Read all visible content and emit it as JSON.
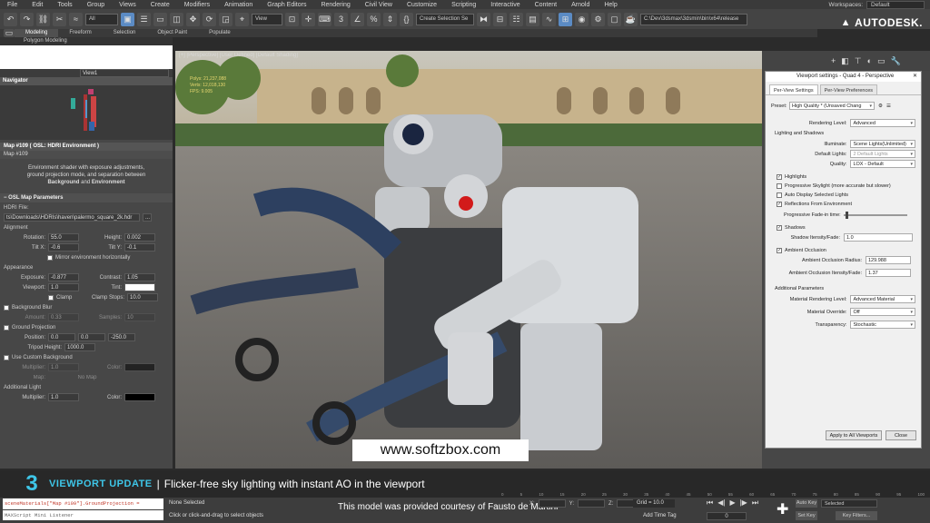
{
  "menu": [
    "File",
    "Edit",
    "Tools",
    "Group",
    "Views",
    "Create",
    "Modifiers",
    "Animation",
    "Graph Editors",
    "Rendering",
    "Civil View",
    "Customize",
    "Scripting",
    "Interactive",
    "Content",
    "Arnold",
    "Help"
  ],
  "workspace": {
    "label": "Workspaces:",
    "value": "Default"
  },
  "toolbar": {
    "filter": "All",
    "view": "View",
    "selection_set": "Create Selection Se",
    "path": "C:\\Dev\\3dsmax\\3dsmin\\bin\\x64\\release"
  },
  "brand": "AUTODESK.",
  "ribbon": {
    "tabs": [
      "Modeling",
      "Freeform",
      "Selection",
      "Object Paint",
      "Populate"
    ],
    "active": "Modeling",
    "sub": "Polygon Modeling"
  },
  "left": {
    "view": "View1",
    "navigator": "Navigator",
    "map_header": "Map #109 ( OSL: HDRI Environment )",
    "map_name": "Map #109",
    "desc": [
      "Environment shader with exposure adjustments,",
      "ground projection mode, and separation between"
    ],
    "desc_bold": [
      "Background",
      "Environment"
    ],
    "desc_and": "and",
    "osl": "OSL Map Parameters",
    "hdri_label": "HDRI File:",
    "hdri": "ts\\Downloads\\HDRIs\\haven\\palermo_square_2k.hdr",
    "alignment": "Alignment",
    "rotation": {
      "label": "Rotation:",
      "value": "55.0"
    },
    "height": {
      "label": "Height:",
      "value": "0.002"
    },
    "tiltx": {
      "label": "Tilt X:",
      "value": "-0.6"
    },
    "tilty": {
      "label": "Tilt Y:",
      "value": "-0.1"
    },
    "mirror": "Mirror environment horizontally",
    "appearance": "Appearance",
    "exposure": {
      "label": "Exposure:",
      "value": "-0.877"
    },
    "contrast": {
      "label": "Contrast:",
      "value": "1.05"
    },
    "viewport": {
      "label": "Viewport:",
      "value": "1.0"
    },
    "tint": "Tint:",
    "clamp": "Clamp",
    "clamp_stops": {
      "label": "Clamp Stops:",
      "value": "10.0"
    },
    "bg_blur": "Background Blur",
    "amount": {
      "label": "Amount:",
      "value": "0.33"
    },
    "samples": {
      "label": "Samples:",
      "value": "10"
    },
    "ground": "Ground Projection",
    "position": {
      "label": "Position:",
      "values": [
        "0.0",
        "0.0",
        "-250.0"
      ]
    },
    "tripod": {
      "label": "Tripod Height:",
      "value": "1000.0"
    },
    "custom_bg": "Use Custom Background",
    "multiplier": {
      "label": "Multiplier:",
      "value": "1.0"
    },
    "color": "Color:",
    "map": "Map:",
    "nomap": "No Map",
    "add_light": "Additional Light",
    "mult2": {
      "label": "Multiplier:",
      "value": "1.0"
    },
    "color2": "Color:"
  },
  "viewport": {
    "label": "[+] [Perspective] [User Defined] [Default Shading]",
    "stats": [
      "Polys:",
      "Verts:",
      "FPS:"
    ],
    "stat_vals": [
      "21,237,088",
      "12,018,130",
      "9.005"
    ]
  },
  "watermark": "www.softzbox.com",
  "banner": {
    "logo": "3",
    "title": "VIEWPORT UPDATE",
    "sep": "|",
    "subtitle": "Flicker-free sky lighting with instant AO in the viewport"
  },
  "status": {
    "script": "sceneMaterials[\"Map #109\"].GroundProjection =",
    "listener": "MAXScript Mini Listener",
    "none": "None Selected",
    "hint": "Click or click-and-drag to select objects",
    "courtesy": "This model was provided courtesy of Fausto de Martini",
    "x": "X:",
    "y": "Y:",
    "z": "Z:",
    "grid": "Grid = 10.0",
    "addtime": "Add Time Tag",
    "frame": "0",
    "autokey": "Auto Key",
    "setkey": "Set Key",
    "selected": "Selected",
    "keyfilters": "Key Filters..."
  },
  "timeline": [
    "0",
    "5",
    "10",
    "15",
    "20",
    "25",
    "30",
    "35",
    "40",
    "45",
    "50",
    "55",
    "60",
    "65",
    "70",
    "75",
    "80",
    "85",
    "90",
    "95",
    "100"
  ],
  "vs": {
    "title": "Viewport settings - Quad 4 - Perspective",
    "tabs": [
      "Per-View Settings",
      "Per-View Preferences"
    ],
    "preset": {
      "label": "Preset:",
      "value": "High Quality * (Unsaved Chang"
    },
    "render_level": {
      "label": "Rendering Level:",
      "value": "Advanced"
    },
    "ls": "Lighting and Shadows",
    "illuminate": {
      "label": "Illuminate:",
      "value": "Scene Lights(Unlimited)"
    },
    "default_lights": {
      "label": "Default Lights:",
      "value": "2 Default Lights"
    },
    "quality": {
      "label": "Quality:",
      "value": "LOX - Default"
    },
    "highlights": "Highlights",
    "prog_sky": "Progressive Skylight (more accurate but slower)",
    "auto_disp": "Auto Display Selected Lights",
    "reflections": "Reflections From Environment",
    "prog_fade": "Progressive Fade-in time:",
    "shadows": "Shadows",
    "shadow_int": {
      "label": "Shadow Itensity/Fade:",
      "value": "1.0"
    },
    "ao": "Ambient Occlusion",
    "ao_radius": {
      "label": "Ambient Occlusion Radius:",
      "value": "129.988"
    },
    "ao_int": {
      "label": "Ambient Occlusion Itensity/Fade:",
      "value": "1.37"
    },
    "add_params": "Additional Parameters",
    "mat_level": {
      "label": "Material Rendering Level:",
      "value": "Advanced Material"
    },
    "mat_override": {
      "label": "Material Override:",
      "value": "Off"
    },
    "transparency": {
      "label": "Transparency:",
      "value": "Stochastic"
    },
    "apply": "Apply to All Viewports",
    "close": "Close"
  }
}
